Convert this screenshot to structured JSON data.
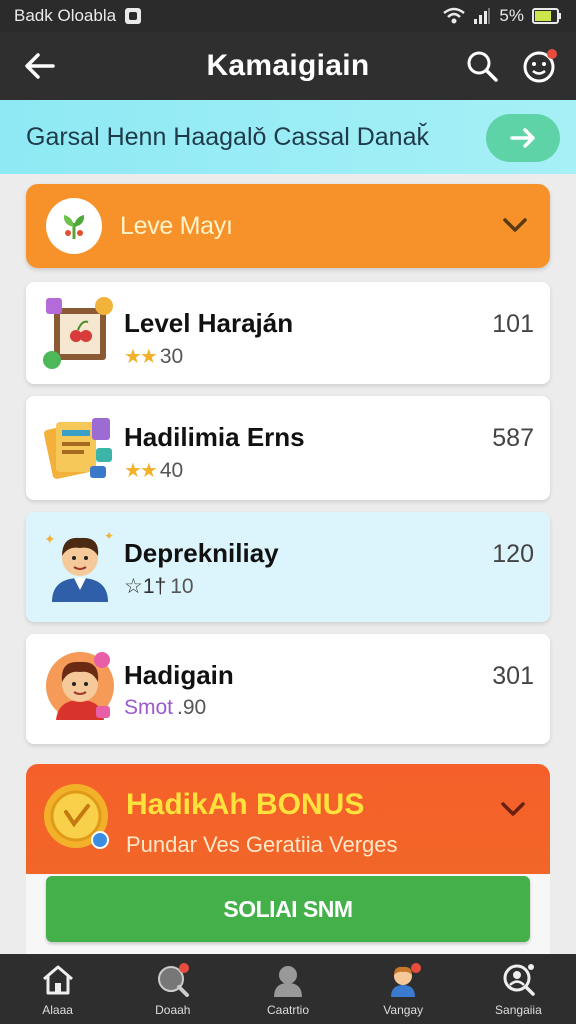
{
  "status_bar": {
    "left_text": "Badk Oloabla",
    "battery": "5%"
  },
  "app_bar": {
    "title": "Kamaigiain"
  },
  "banner": {
    "text": "Garsal Henn Haagalǒ Cassal Danaǩ"
  },
  "level_header": {
    "title": "Leve Mayı"
  },
  "items": [
    {
      "name": "Level Haraján",
      "meta_text": "30",
      "count": "101",
      "stars": "★★",
      "icon": "picture-frame-icon"
    },
    {
      "name": "Hadilimia Erns",
      "meta_text": "40",
      "count": "587",
      "stars": "★★",
      "icon": "documents-icon"
    },
    {
      "name": "Deprekniliay",
      "meta_prefix": "☆1†",
      "meta_text": "10",
      "count": "120",
      "icon": "man-avatar-icon"
    },
    {
      "name": "Hadigain",
      "meta_prefix": "Smot",
      "meta_text": ".90",
      "count": "301",
      "icon": "woman-avatar-icon"
    }
  ],
  "bonus": {
    "title": "HadikAh BONUS",
    "subtitle": "Pundar Ves Geratiia Verges",
    "button_label": "SOLIAI SNM"
  },
  "bottom_nav": [
    {
      "label": "Alaaa",
      "icon": "home-icon"
    },
    {
      "label": "Doaah",
      "icon": "search-icon"
    },
    {
      "label": "Caatrtio",
      "icon": "person-icon"
    },
    {
      "label": "Vangay",
      "icon": "avatar-icon"
    },
    {
      "label": "Sangaiia",
      "icon": "search-user-icon"
    }
  ],
  "colors": {
    "accent_orange": "#f7922b",
    "bonus_orange": "#f5602a",
    "cta_green": "#43b04a",
    "banner_cyan": "#8ee9f4",
    "star_gold": "#f1b22a"
  }
}
